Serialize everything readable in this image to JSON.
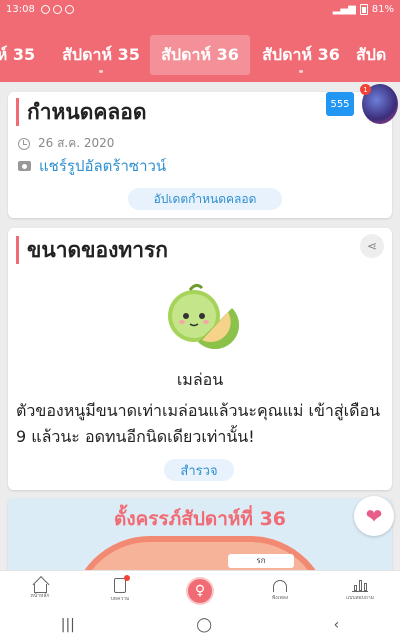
{
  "status_bar": {
    "time": "13:08",
    "battery": "81%"
  },
  "week_tabs": [
    "ห์ 35",
    "สัปดาห์ 35",
    "สัปดาห์ 36",
    "สัปดาห์ 36",
    "สัปด"
  ],
  "active_tab_index": 2,
  "due_card": {
    "title": "กำหนดคลอด",
    "date": "26 ส.ค. 2020",
    "share_link": "แชร์รูปอัลตร้าซาวน์",
    "update_button": "อัปเดตกำหนดคลอด"
  },
  "floating": {
    "badge_text": "555",
    "avatar_notif": "1"
  },
  "baby_size_card": {
    "title": "ขนาดของทารก",
    "fruit_name": "เมล่อน",
    "description": "ตัวของหนูมีขนาดเท่าเมล่อนแล้วนะคุณแม่ เข้าสู่เดือน 9 แล้วนะ อดทนอีกนิดเดียวเท่านั้น!",
    "explore_button": "สำรวจ"
  },
  "banner": {
    "title": "ตั้งครรภ์สัปดาห์ที่ 36",
    "chip": "รก"
  },
  "bottom_nav": [
    {
      "label": "หน้าหลัก",
      "icon": "home-icon"
    },
    {
      "label": "บทความ",
      "icon": "article-icon"
    },
    {
      "label": "",
      "icon": "pregnancy-icon"
    },
    {
      "label": "ฟังเพลง",
      "icon": "headphones-icon"
    },
    {
      "label": "แบบสอบถาม",
      "icon": "chart-icon"
    }
  ],
  "colors": {
    "brand": "#f06b74",
    "link": "#2f8fd0"
  }
}
